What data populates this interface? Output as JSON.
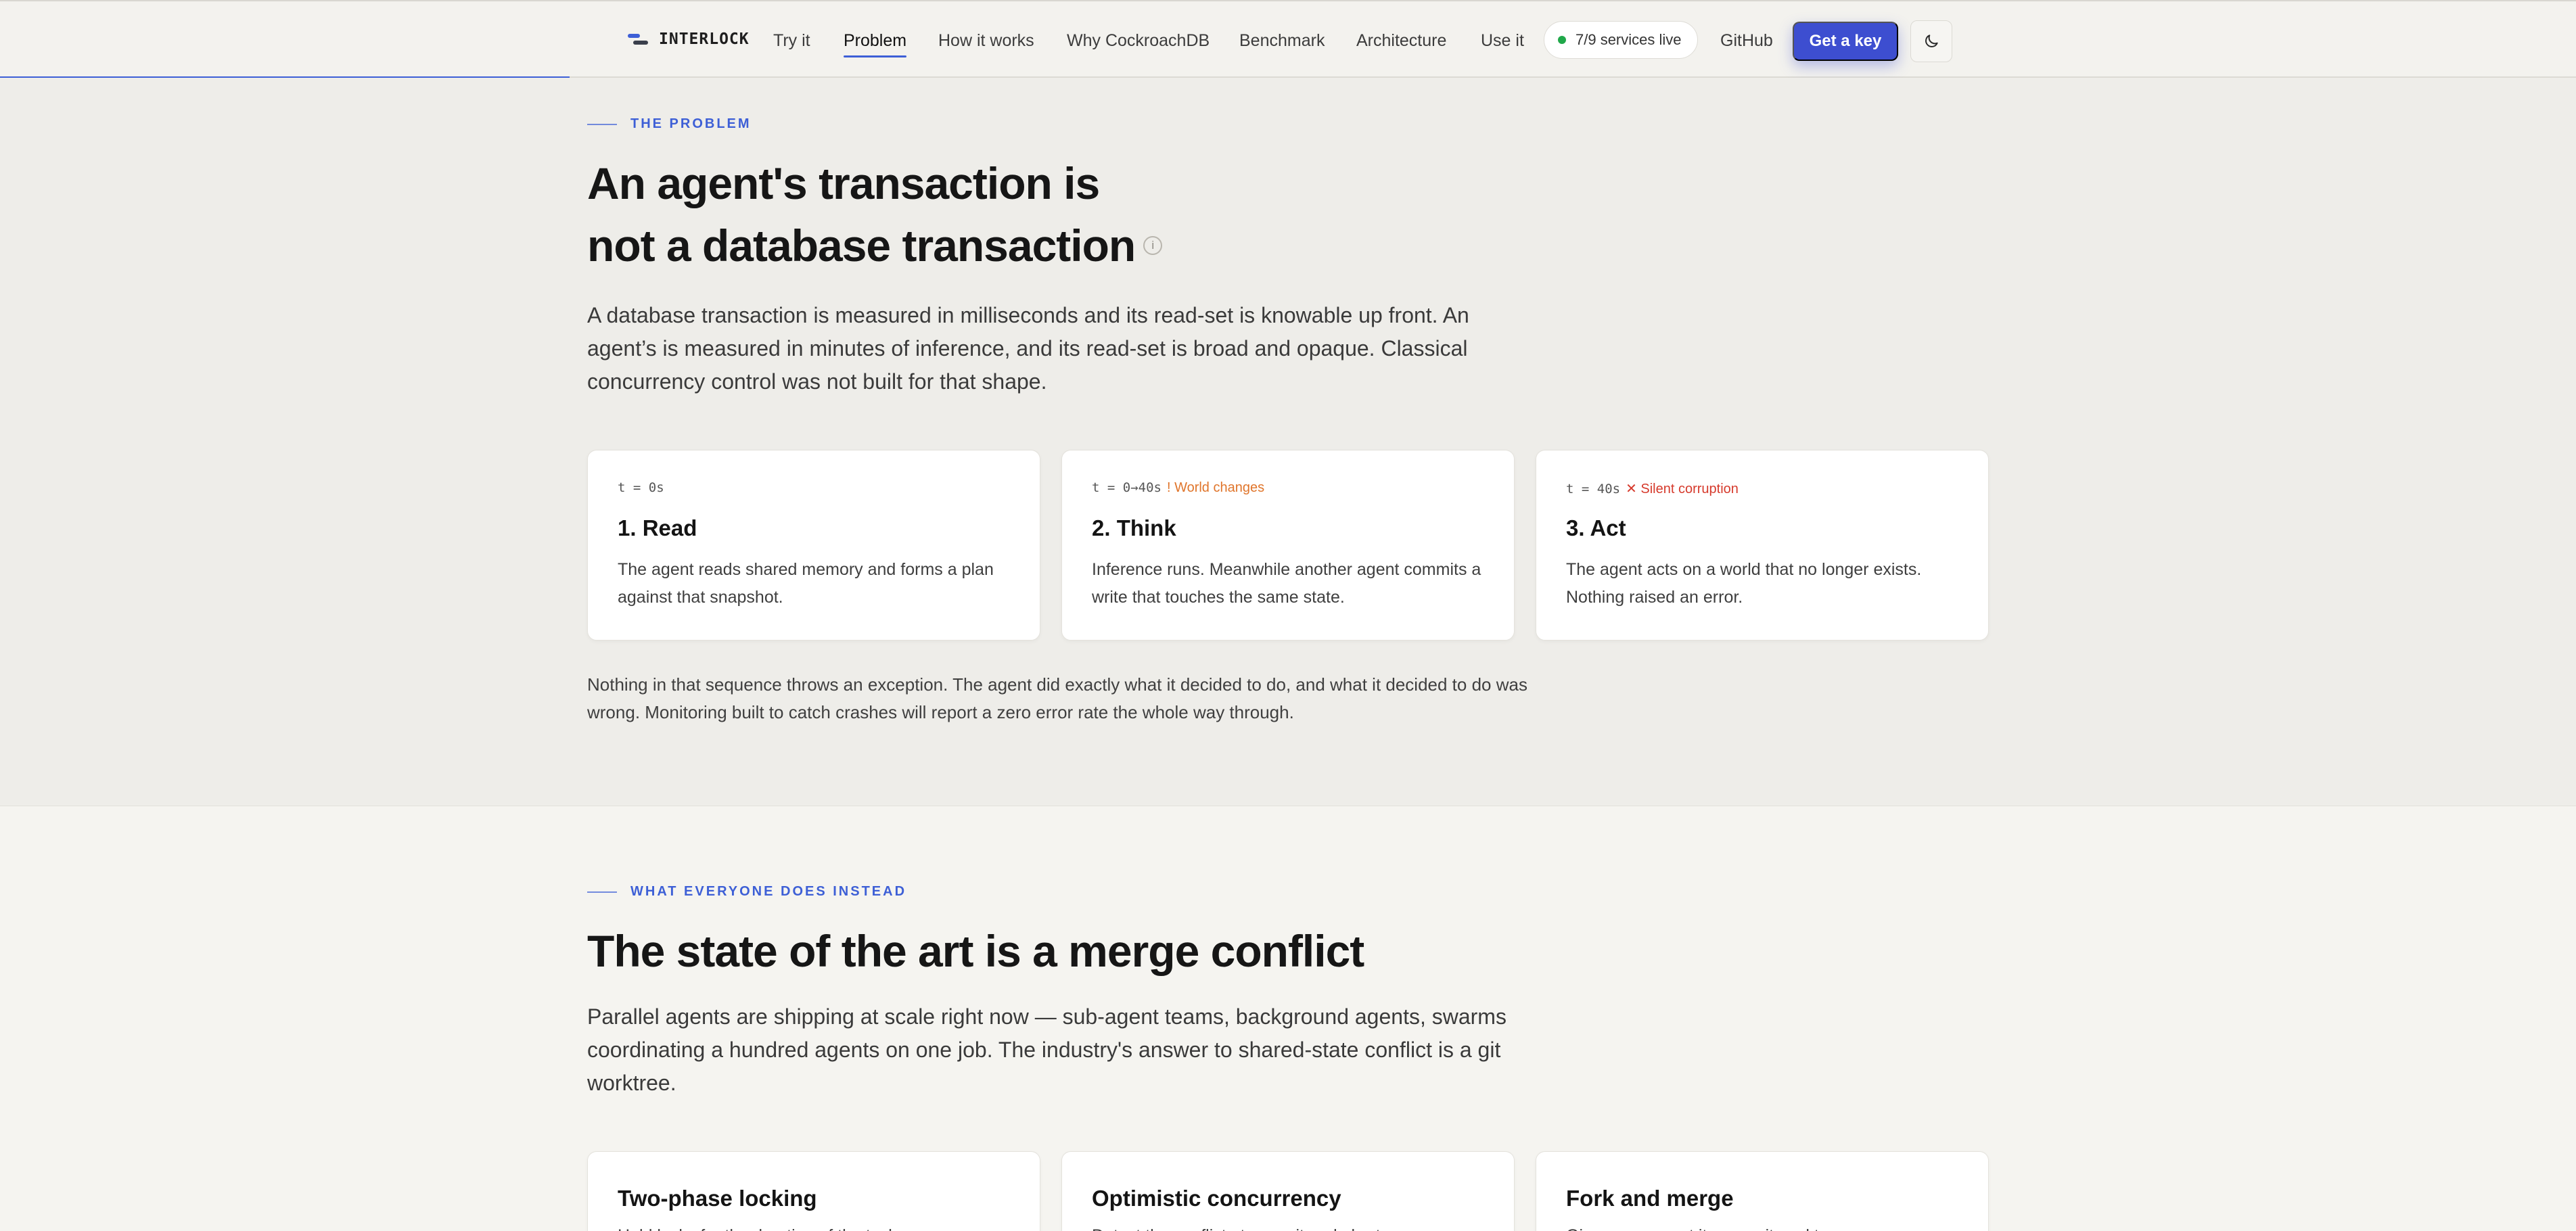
{
  "brand": {
    "name": "INTERLOCK"
  },
  "nav": {
    "items": [
      {
        "label": "Try it"
      },
      {
        "label": "Problem",
        "active": true
      },
      {
        "label": "How it works"
      },
      {
        "label": "Why CockroachDB"
      },
      {
        "label": "Benchmark"
      },
      {
        "label": "Architecture"
      },
      {
        "label": "Use it"
      }
    ],
    "status": "7/9 services live",
    "github": "GitHub",
    "cta": "Get a key",
    "theme_icon": "moon-icon"
  },
  "colors": {
    "accent": "#3d5fd6",
    "cta": "#3d4ed0",
    "status_live": "#20a84a",
    "warning": "#e0752b",
    "error": "#d63a2c"
  },
  "problem": {
    "eyebrow": "THE PROBLEM",
    "title_line1": "An agent's transaction is",
    "title_line2": "not a database transaction",
    "info_icon": "i",
    "lede": "A database transaction is measured in milliseconds and its read-set is knowable up front. An agent’s is measured in minutes of inference, and its read-set is broad and opaque. Classical concurrency control was not built for that shape.",
    "cards": [
      {
        "time": "t = 0s",
        "flag": "",
        "title": "1. Read",
        "desc": "The agent reads shared memory and forms a plan against that snapshot."
      },
      {
        "time": "t = 0→40s",
        "flag": "! World changes",
        "title": "2. Think",
        "desc": "Inference runs. Meanwhile another agent commits a write that touches the same state."
      },
      {
        "time": "t = 40s",
        "flag": "✕ Silent corruption",
        "title": "3. Act",
        "desc": "The agent acts on a world that no longer exists. Nothing raised an error."
      }
    ],
    "note": "Nothing in that sequence throws an exception. The agent did exactly what it decided to do, and what it decided to do was wrong. Monitoring built to catch crashes will report a zero error rate the whole way through."
  },
  "instead": {
    "eyebrow": "WHAT EVERYONE DOES INSTEAD",
    "title": "The state of the art is a merge conflict",
    "lede": "Parallel agents are shipping at scale right now — sub-agent teams, background agents, swarms coordinating a hundred agents on one job. The industry's answer to shared-state conflict is a git worktree.",
    "cards": [
      {
        "title": "Two-phase locking",
        "desc": "Hold locks for the duration of the task."
      },
      {
        "title": "Optimistic concurrency",
        "desc": "Detect the conflict at commit and abort."
      },
      {
        "title": "Fork and merge",
        "desc": "Give every agent its own git worktree."
      }
    ]
  }
}
